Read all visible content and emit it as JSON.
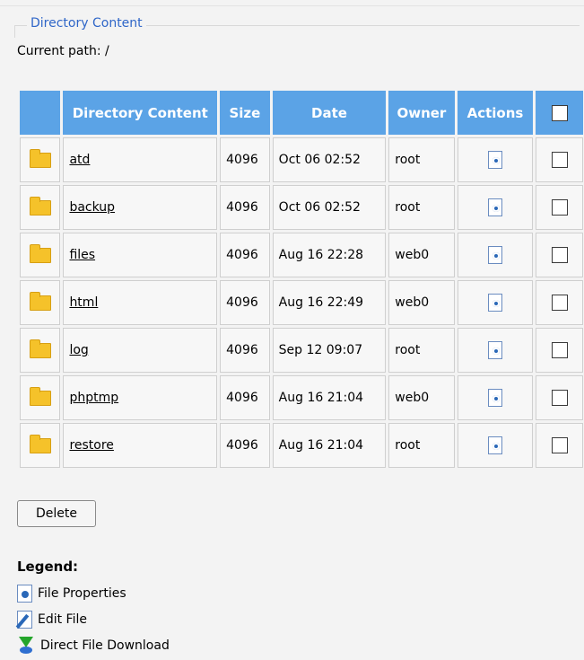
{
  "fieldset": {
    "legend": "Directory Content"
  },
  "current_path": "Current path: /",
  "table": {
    "headers": [
      "",
      "Directory Content",
      "Size",
      "Date",
      "Owner",
      "Actions",
      ""
    ],
    "rows": [
      {
        "name": "atd",
        "size": "4096",
        "date": "Oct 06 02:52",
        "owner": "root"
      },
      {
        "name": "backup",
        "size": "4096",
        "date": "Oct 06 02:52",
        "owner": "root"
      },
      {
        "name": "files",
        "size": "4096",
        "date": "Aug 16 22:28",
        "owner": "web0"
      },
      {
        "name": "html",
        "size": "4096",
        "date": "Aug 16 22:49",
        "owner": "web0"
      },
      {
        "name": "log",
        "size": "4096",
        "date": "Sep 12 09:07",
        "owner": "root"
      },
      {
        "name": "phptmp",
        "size": "4096",
        "date": "Aug 16 21:04",
        "owner": "web0"
      },
      {
        "name": "restore",
        "size": "4096",
        "date": "Aug 16 21:04",
        "owner": "root"
      }
    ]
  },
  "delete_label": "Delete",
  "legend": {
    "title": "Legend:",
    "items": [
      "File Properties",
      "Edit File",
      "Direct File Download"
    ]
  },
  "colors": {
    "header_bg": "#5ba3e6",
    "legend_title": "#2f66c8",
    "folder": "#f5c22a"
  }
}
